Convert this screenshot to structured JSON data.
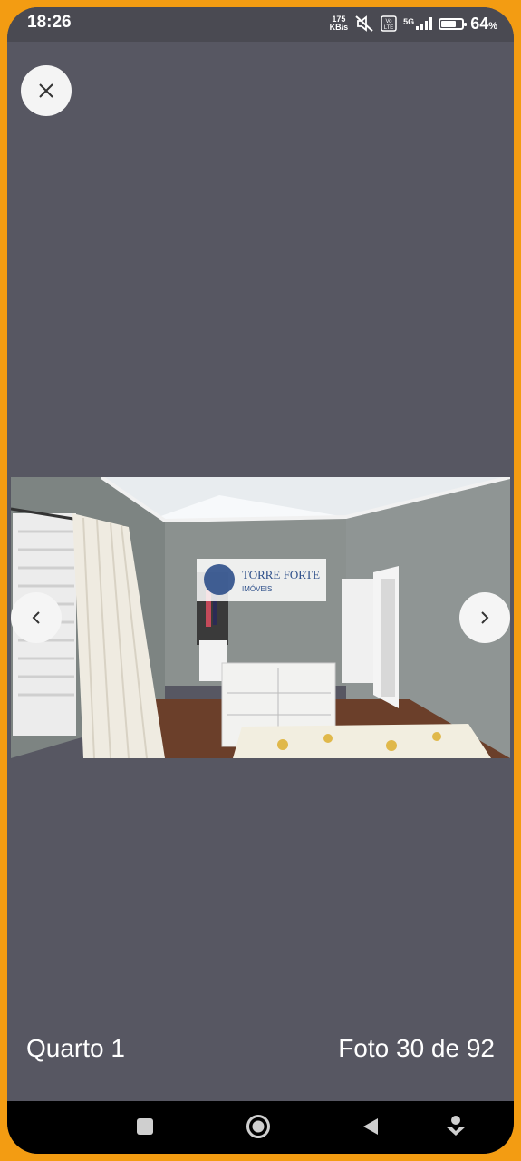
{
  "status_bar": {
    "time": "18:26",
    "net_speed_value": "175",
    "net_speed_unit": "KB/s",
    "volte_label": "Vo LTE",
    "network_type": "5G",
    "battery_percent": "64",
    "battery_unit": "%",
    "battery_level": 0.64,
    "icons": [
      "mute-icon",
      "volte-icon",
      "signal-icon",
      "battery-icon"
    ]
  },
  "viewer": {
    "close_icon": "close-icon",
    "prev_icon": "chevron-left-icon",
    "next_icon": "chevron-right-icon",
    "photo": {
      "watermark_brand": "TORRE FORTE",
      "watermark_sub": "IMÓVEIS"
    },
    "caption": "Quarto 1",
    "counter": "Foto 30 de 92",
    "current_photo": 30,
    "total_photos": 92
  },
  "system_nav": {
    "icons": [
      "recents-square-icon",
      "home-circle-icon",
      "back-triangle-icon",
      "assistant-icon"
    ]
  },
  "colors": {
    "frame_border": "#f39c12",
    "viewer_background": "#575762",
    "status_bar_background": "#4a4a52"
  }
}
